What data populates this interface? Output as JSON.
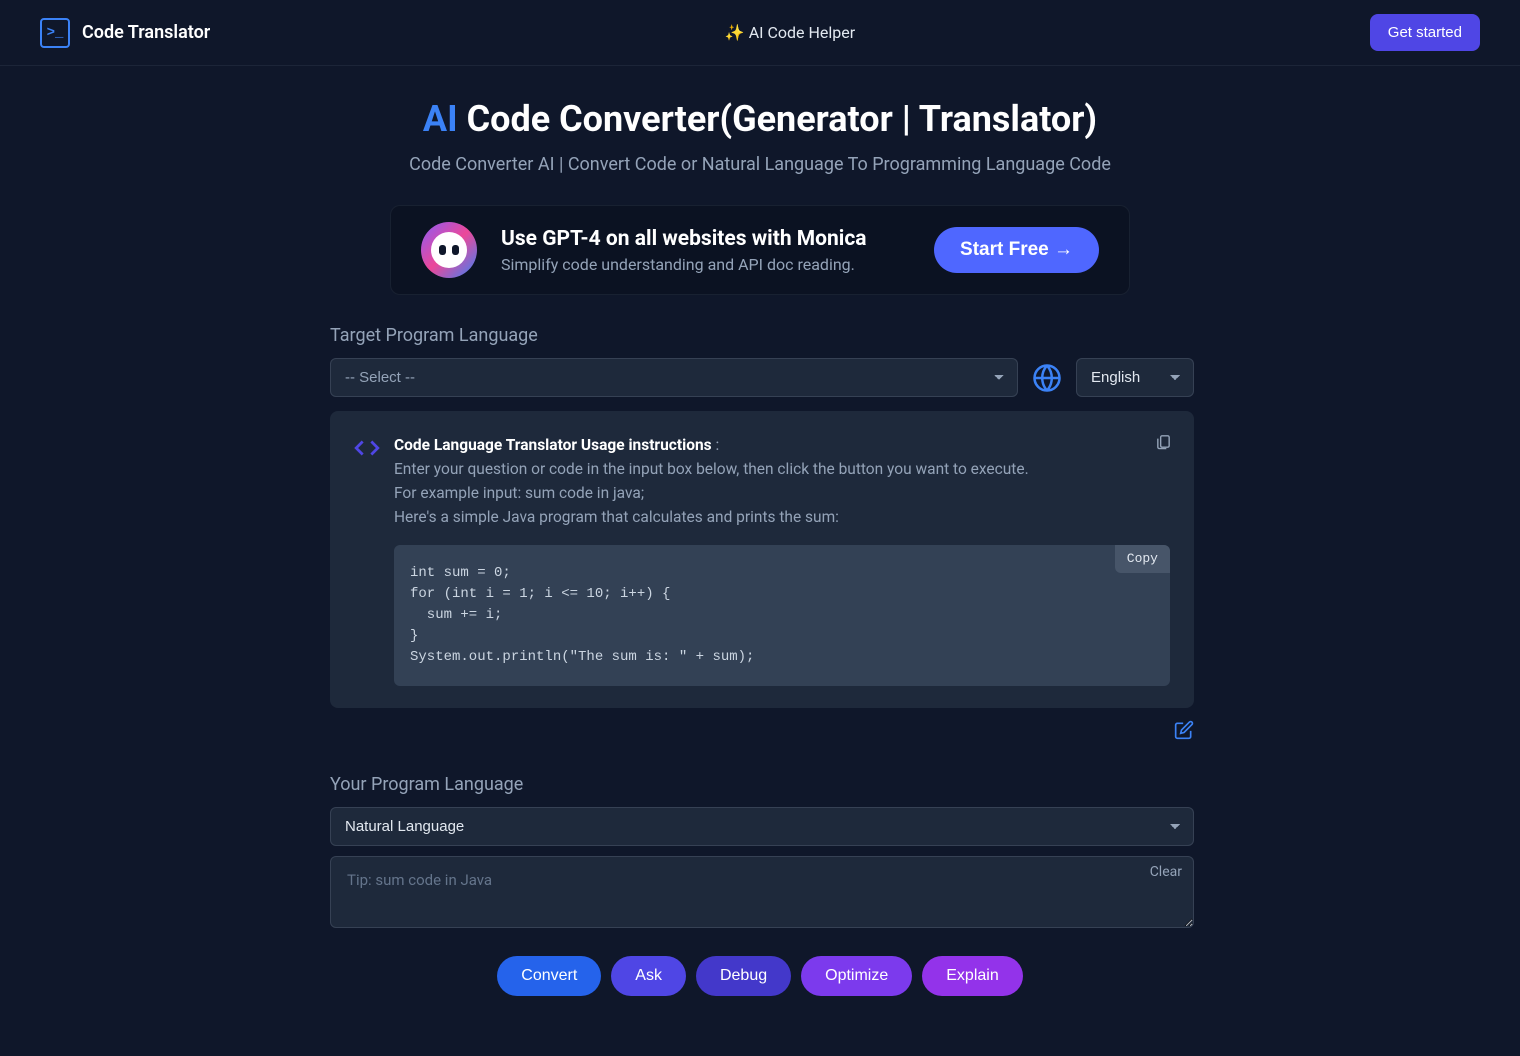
{
  "header": {
    "brand": "Code Translator",
    "center": "✨ AI Code Helper",
    "cta": "Get started"
  },
  "hero": {
    "ai": "AI",
    "rest": " Code Converter(Generator | Translator)",
    "subtitle": "Code Converter AI | Convert Code or Natural Language To Programming Language Code"
  },
  "promo": {
    "heading": "Use GPT-4 on all websites with Monica",
    "sub": "Simplify code understanding and API doc reading.",
    "cta": "Start Free  →"
  },
  "target": {
    "label": "Target Program Language",
    "select": "-- Select --",
    "lang": "English"
  },
  "panel": {
    "strong": "Code Language Translator Usage instructions",
    "colon": " :",
    "l1": "Enter your question or code in the input box below, then click the button you want to execute.",
    "l2": "For example input: sum code in java;",
    "l3": "Here's a simple Java program that calculates and prints the sum:",
    "copy": "Copy",
    "code": "int sum = 0;\nfor (int i = 1; i <= 10; i++) {\n  sum += i;\n}\nSystem.out.println(\"The sum is: \" + sum);"
  },
  "input": {
    "label": "Your Program Language",
    "select": "Natural Language",
    "placeholder": "Tip: sum code in Java",
    "clear": "Clear"
  },
  "actions": {
    "convert": "Convert",
    "ask": "Ask",
    "debug": "Debug",
    "optimize": "Optimize",
    "explain": "Explain"
  }
}
